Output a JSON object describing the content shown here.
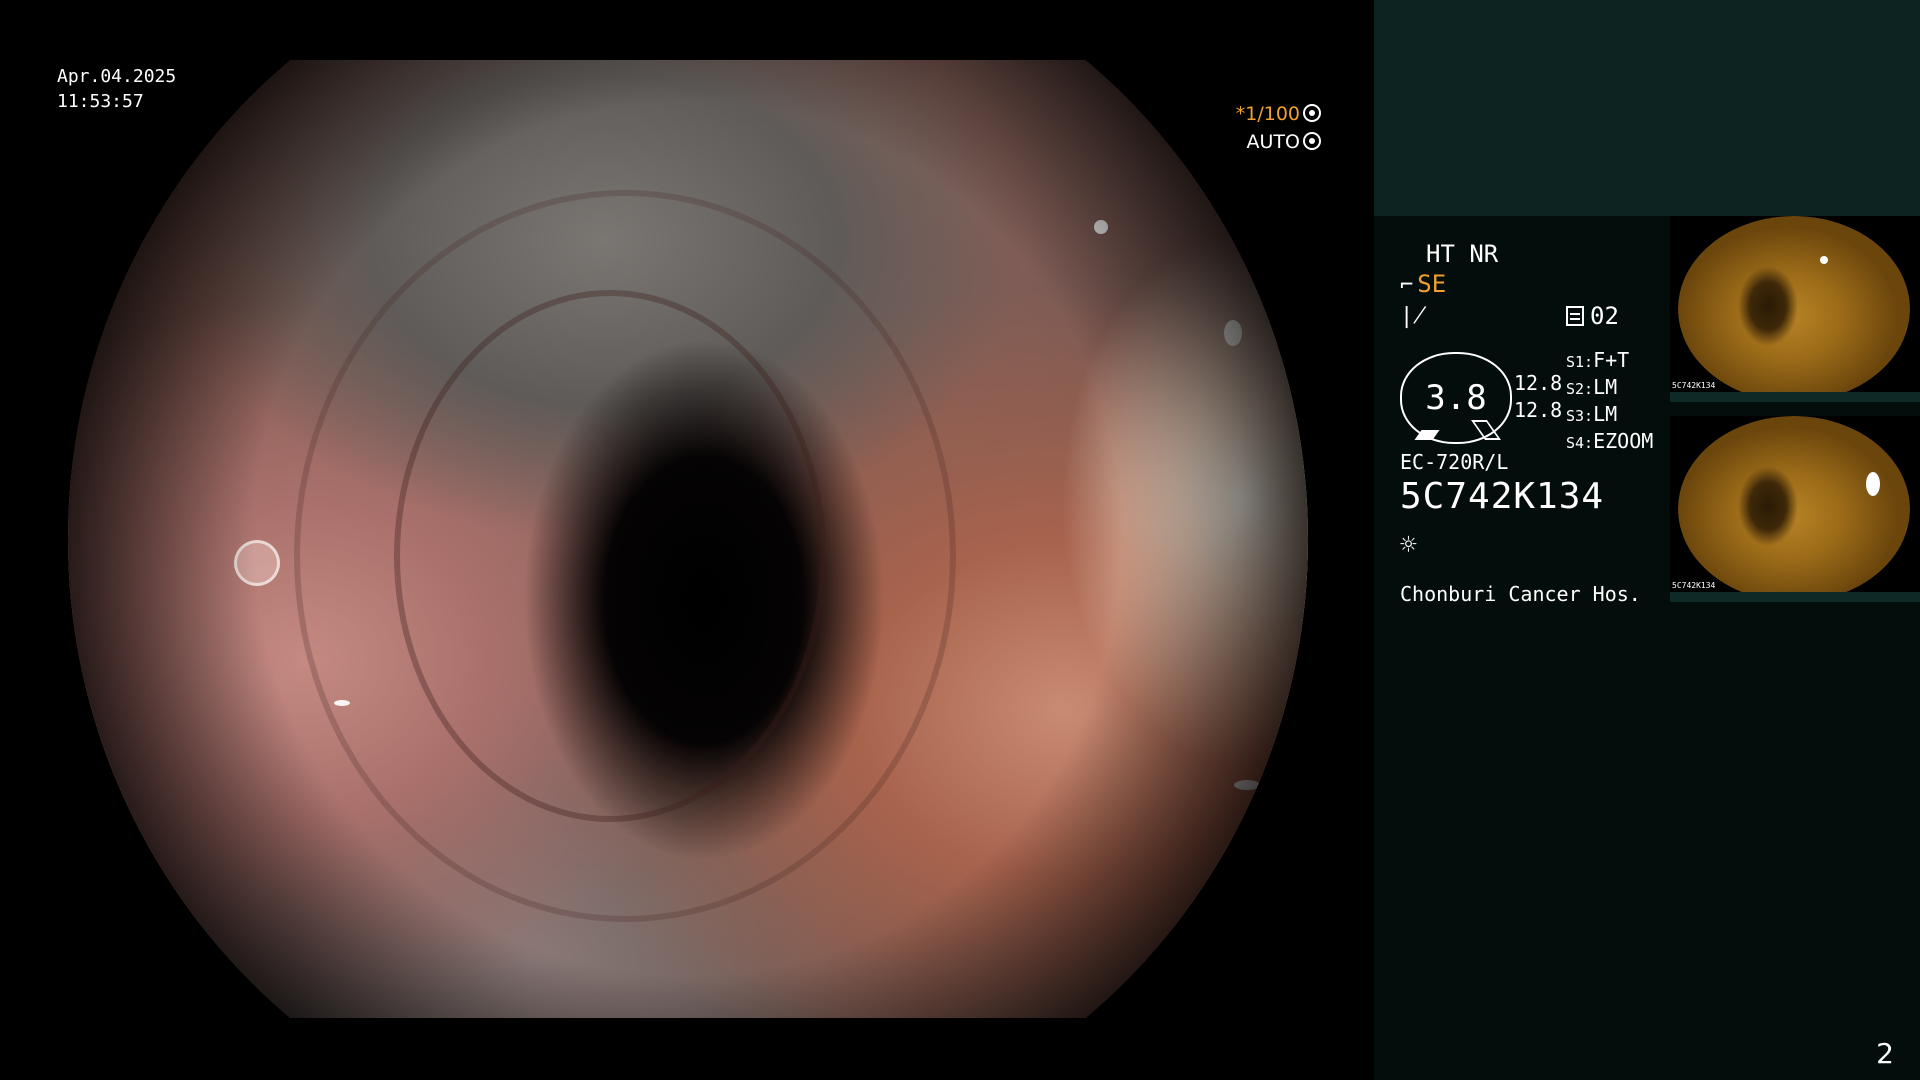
{
  "view": {
    "date": "Apr.04.2025",
    "time": "11:53:57",
    "shutter": "*1/100",
    "iris_mode": "AUTO"
  },
  "panel": {
    "ht_nr": "HT NR",
    "structure_mode": "SE",
    "memory": "02",
    "dial_value": "3.8",
    "dial_readings": [
      "12.8",
      "12.8"
    ],
    "switches": [
      {
        "key": "S1:",
        "value": "F+T"
      },
      {
        "key": "S2:",
        "value": "LM"
      },
      {
        "key": "S3:",
        "value": "LM"
      },
      {
        "key": "S4:",
        "value": "EZOOM"
      }
    ],
    "scope_model": "EC-720R/L",
    "serial_number": "5C742K134",
    "hospital": "Chonburi Cancer Hos.",
    "icons": [
      "structure-enhancement-icon",
      "color-enhancement-icon",
      "memory-icon",
      "brightness-icon"
    ]
  },
  "thumbnails": [
    {
      "caption": "5C742K134"
    },
    {
      "caption": "5C742K134"
    }
  ],
  "page_number": "2",
  "colors": {
    "accent": "#f0a030",
    "panel_bg": "#030d0b",
    "panel_top": "#0d2322",
    "thumb_tone": "#b88425"
  }
}
